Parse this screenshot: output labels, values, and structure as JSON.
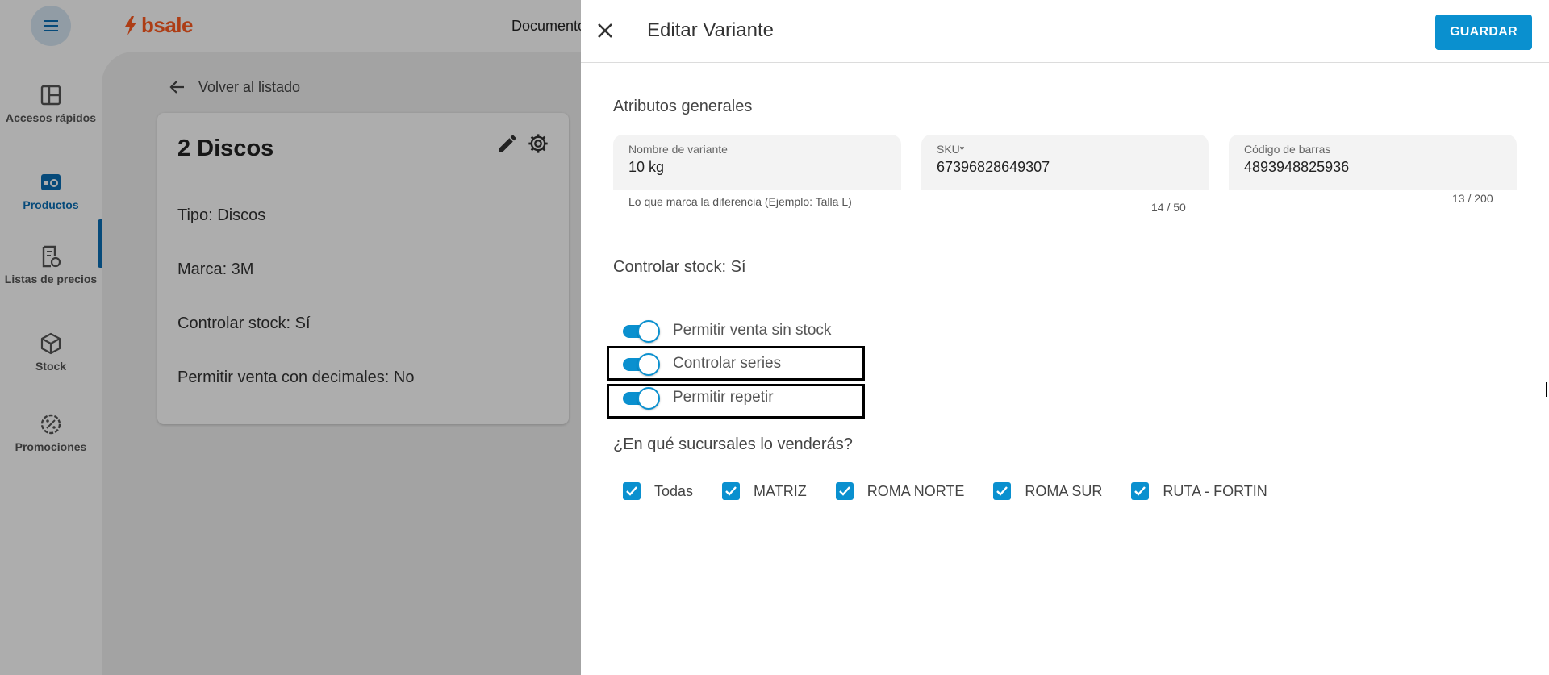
{
  "app": {
    "brand": "bsale",
    "top_nav": "Documento",
    "sidebar": {
      "items": [
        {
          "label": "Accesos rápidos",
          "icon": "dashboard-icon"
        },
        {
          "label": "Productos",
          "icon": "products-icon",
          "active": true
        },
        {
          "label": "Listas de precios",
          "icon": "price-list-icon"
        },
        {
          "label": "Stock",
          "icon": "box-icon"
        },
        {
          "label": "Promociones",
          "icon": "promotion-icon"
        }
      ]
    },
    "back_link": "Volver al listado",
    "product_card": {
      "title": "2 Discos",
      "lines": [
        "Tipo: Discos",
        "Marca: 3M",
        "Controlar stock: Sí",
        "Permitir venta con decimales: No"
      ]
    }
  },
  "drawer": {
    "title": "Editar Variante",
    "save_label": "GUARDAR",
    "general_title": "Atributos generales",
    "fields": [
      {
        "label": "Nombre de variante",
        "value": "10 kg",
        "hint": "Lo que marca la diferencia (Ejemplo: Talla L)"
      },
      {
        "label": "SKU*",
        "value": "67396828649307",
        "counter": "14 / 50"
      },
      {
        "label": "Código de barras",
        "value": "4893948825936",
        "counter": "13 / 200"
      }
    ],
    "stock_control": "Controlar stock: Sí",
    "toggles": [
      {
        "label": "Permitir venta sin stock",
        "on": true
      },
      {
        "label": "Controlar series",
        "on": true
      },
      {
        "label": "Permitir repetir",
        "on": true
      }
    ],
    "branches_title": "¿En qué sucursales lo venderás?",
    "branches": [
      {
        "label": "Todas",
        "checked": true
      },
      {
        "label": "MATRIZ",
        "checked": true
      },
      {
        "label": "ROMA NORTE",
        "checked": true
      },
      {
        "label": "ROMA SUR",
        "checked": true
      },
      {
        "label": "RUTA - FORTIN",
        "checked": true
      }
    ]
  },
  "colors": {
    "accent": "#0a90cf",
    "brand": "#ff5a1f",
    "sidebar_active": "#0a6eb4"
  }
}
